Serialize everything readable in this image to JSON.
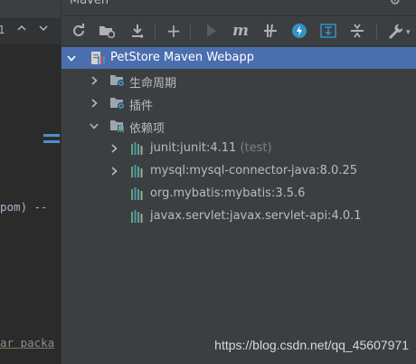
{
  "editor": {
    "gutter_number": "1",
    "fragment_pom": "pom) --",
    "fragment_package": "ar packa"
  },
  "maven": {
    "title": "Maven",
    "toolbar": {
      "reload": "reload-icon",
      "generate_sources": "folder-refresh-icon",
      "download": "download-icon",
      "add": "+",
      "run": "run-icon",
      "execute_goal": "m",
      "skip_tests": "skip-tests-icon",
      "offline": "offline-icon",
      "show_dependencies": "show-dependencies-icon",
      "collapse_all": "collapse-all-icon",
      "settings": "wrench-icon"
    },
    "tree": {
      "project": "PetStore Maven Webapp",
      "lifecycle": "生命周期",
      "plugins": "插件",
      "dependencies": "依赖项",
      "deps": [
        {
          "name": "junit:junit:4.11",
          "scope": "(test)",
          "expandable": true
        },
        {
          "name": "mysql:mysql-connector-java:8.0.25",
          "scope": "",
          "expandable": true
        },
        {
          "name": "org.mybatis:mybatis:3.5.6",
          "scope": "",
          "expandable": false
        },
        {
          "name": "javax.servlet:javax.servlet-api:4.0.1",
          "scope": "",
          "expandable": false
        }
      ]
    }
  },
  "watermark": "https://blog.csdn.net/qq_45607971",
  "colors": {
    "selection": "#4b6eaf",
    "panel": "#3c3f41",
    "editor": "#2b2b2b",
    "text": "#bbbbbb",
    "maven_blue": "#4e8fcd"
  }
}
